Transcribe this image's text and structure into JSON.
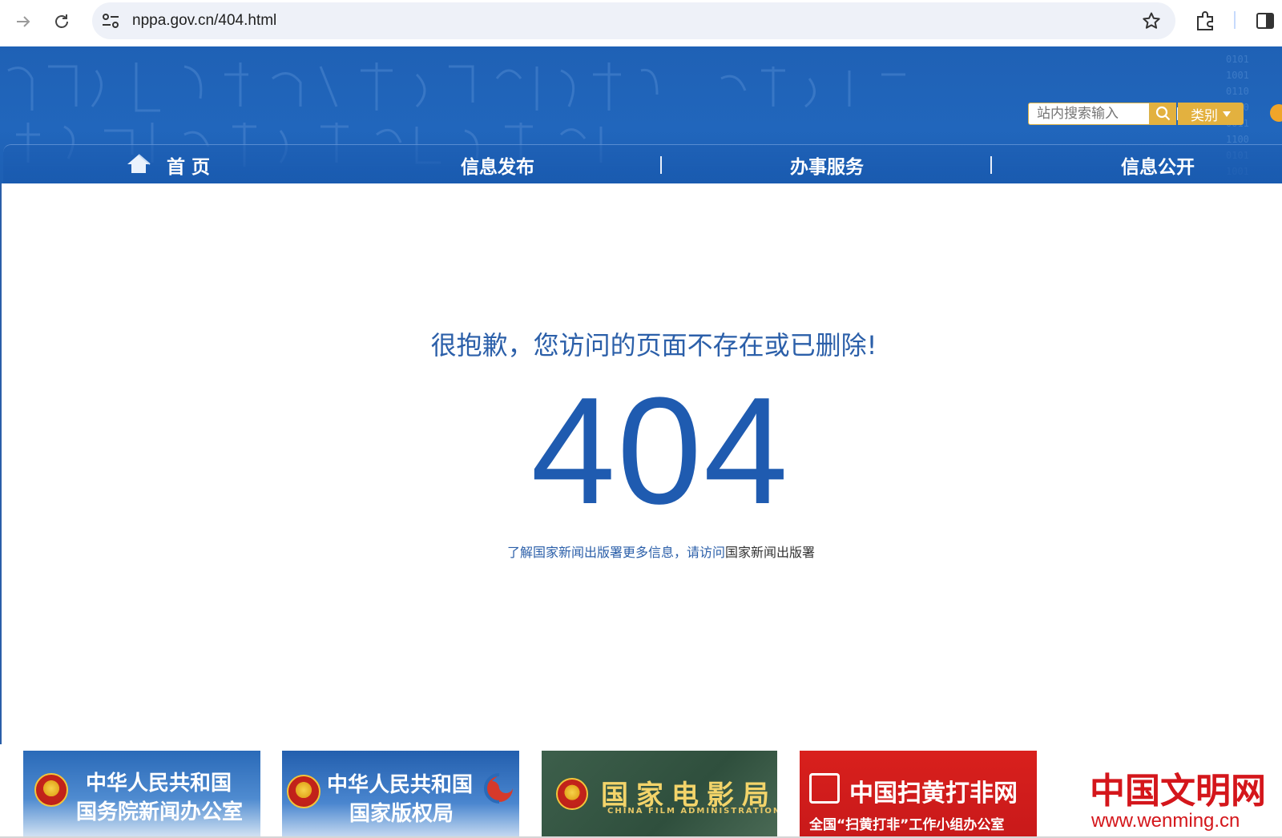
{
  "browser": {
    "url": "nppa.gov.cn/404.html"
  },
  "header": {
    "search_placeholder": "站内搜索输入",
    "category_label": "类别",
    "nav": {
      "home": "首 页",
      "info_release": "信息发布",
      "services": "办事服务",
      "disclosure": "信息公开"
    }
  },
  "error": {
    "message": "很抱歉，您访问的页面不存在或已删除!",
    "code": "404",
    "link_prefix": "了解国家新闻出版署更多信息，请访问",
    "link_target": "国家新闻出版署"
  },
  "banners": [
    {
      "line1": "中华人民共和国",
      "line2": "国务院新闻办公室"
    },
    {
      "line1": "中华人民共和国",
      "line2": "国家版权局"
    },
    {
      "line1": "国家电影局",
      "line2": "CHINA FILM ADMINISTRATION"
    },
    {
      "line1": "中国扫黄打非网",
      "line2": "全国“扫黄打非”工作小组办公室"
    },
    {
      "line1": "中国文明网",
      "line2": "www.wenming.cn"
    }
  ],
  "colors": {
    "header_blue": "#2166bc",
    "accent_gold": "#e3b13f",
    "error_blue": "#1f5bb0"
  }
}
